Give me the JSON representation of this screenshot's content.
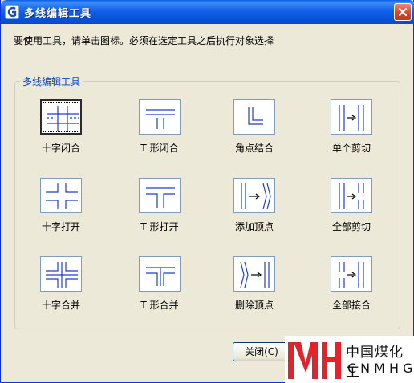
{
  "window": {
    "title": "多线编辑工具"
  },
  "instructions": "要使用工具，请单击图标。必须在选定工具之后执行对象选择",
  "group": {
    "legend": "多线编辑工具"
  },
  "tools": [
    {
      "label": "十字闭合",
      "icon": "cross-closed-icon"
    },
    {
      "label": "T 形闭合",
      "icon": "tee-closed-icon"
    },
    {
      "label": "角点结合",
      "icon": "corner-joint-icon"
    },
    {
      "label": "单个剪切",
      "icon": "cut-single-icon"
    },
    {
      "label": "十字打开",
      "icon": "cross-open-icon"
    },
    {
      "label": "T 形打开",
      "icon": "tee-open-icon"
    },
    {
      "label": "添加顶点",
      "icon": "add-vertex-icon"
    },
    {
      "label": "全部剪切",
      "icon": "cut-all-icon"
    },
    {
      "label": "十字合并",
      "icon": "cross-merged-icon"
    },
    {
      "label": "T 形合并",
      "icon": "tee-merged-icon"
    },
    {
      "label": "删除顶点",
      "icon": "delete-vertex-icon"
    },
    {
      "label": "全部接合",
      "icon": "weld-all-icon"
    }
  ],
  "buttons": {
    "close": "关闭(C)"
  },
  "watermark": {
    "cn": "中国煤化工",
    "en": "CNMHG"
  },
  "colors": {
    "titlebar": "#0552d7",
    "legend": "#0046d5",
    "icon_line": "#1a3fd0",
    "watermark_red": "#e1232b"
  }
}
